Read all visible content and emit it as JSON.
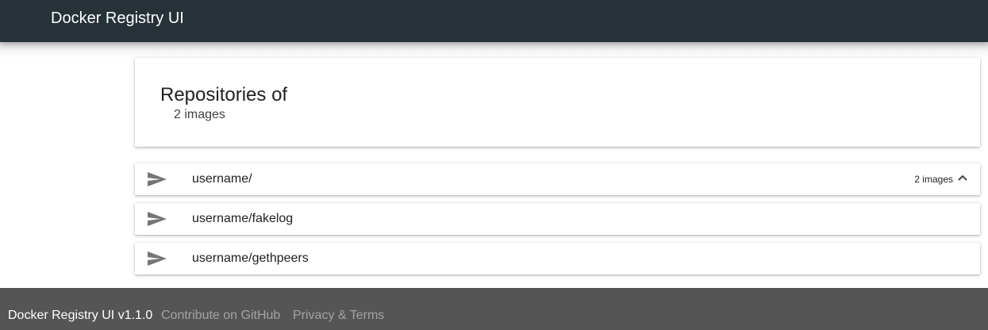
{
  "header": {
    "title": "Docker Registry UI"
  },
  "catalog": {
    "heading": "Repositories of",
    "count_label": "2 images"
  },
  "repositories": [
    {
      "name": "username/",
      "meta": "2 images",
      "icon": "send-icon",
      "expanded": true
    },
    {
      "name": "username/fakelog",
      "icon": "send-icon"
    },
    {
      "name": "username/gethpeers",
      "icon": "send-icon"
    }
  ],
  "footer": {
    "version": "Docker Registry UI v1.1.0",
    "contribute": "Contribute on GitHub",
    "privacy": "Privacy & Terms"
  },
  "colors": {
    "header_bg": "#263238",
    "footer_bg": "#555555",
    "footer_link": "#a3a3a3",
    "icon": "#757575"
  }
}
